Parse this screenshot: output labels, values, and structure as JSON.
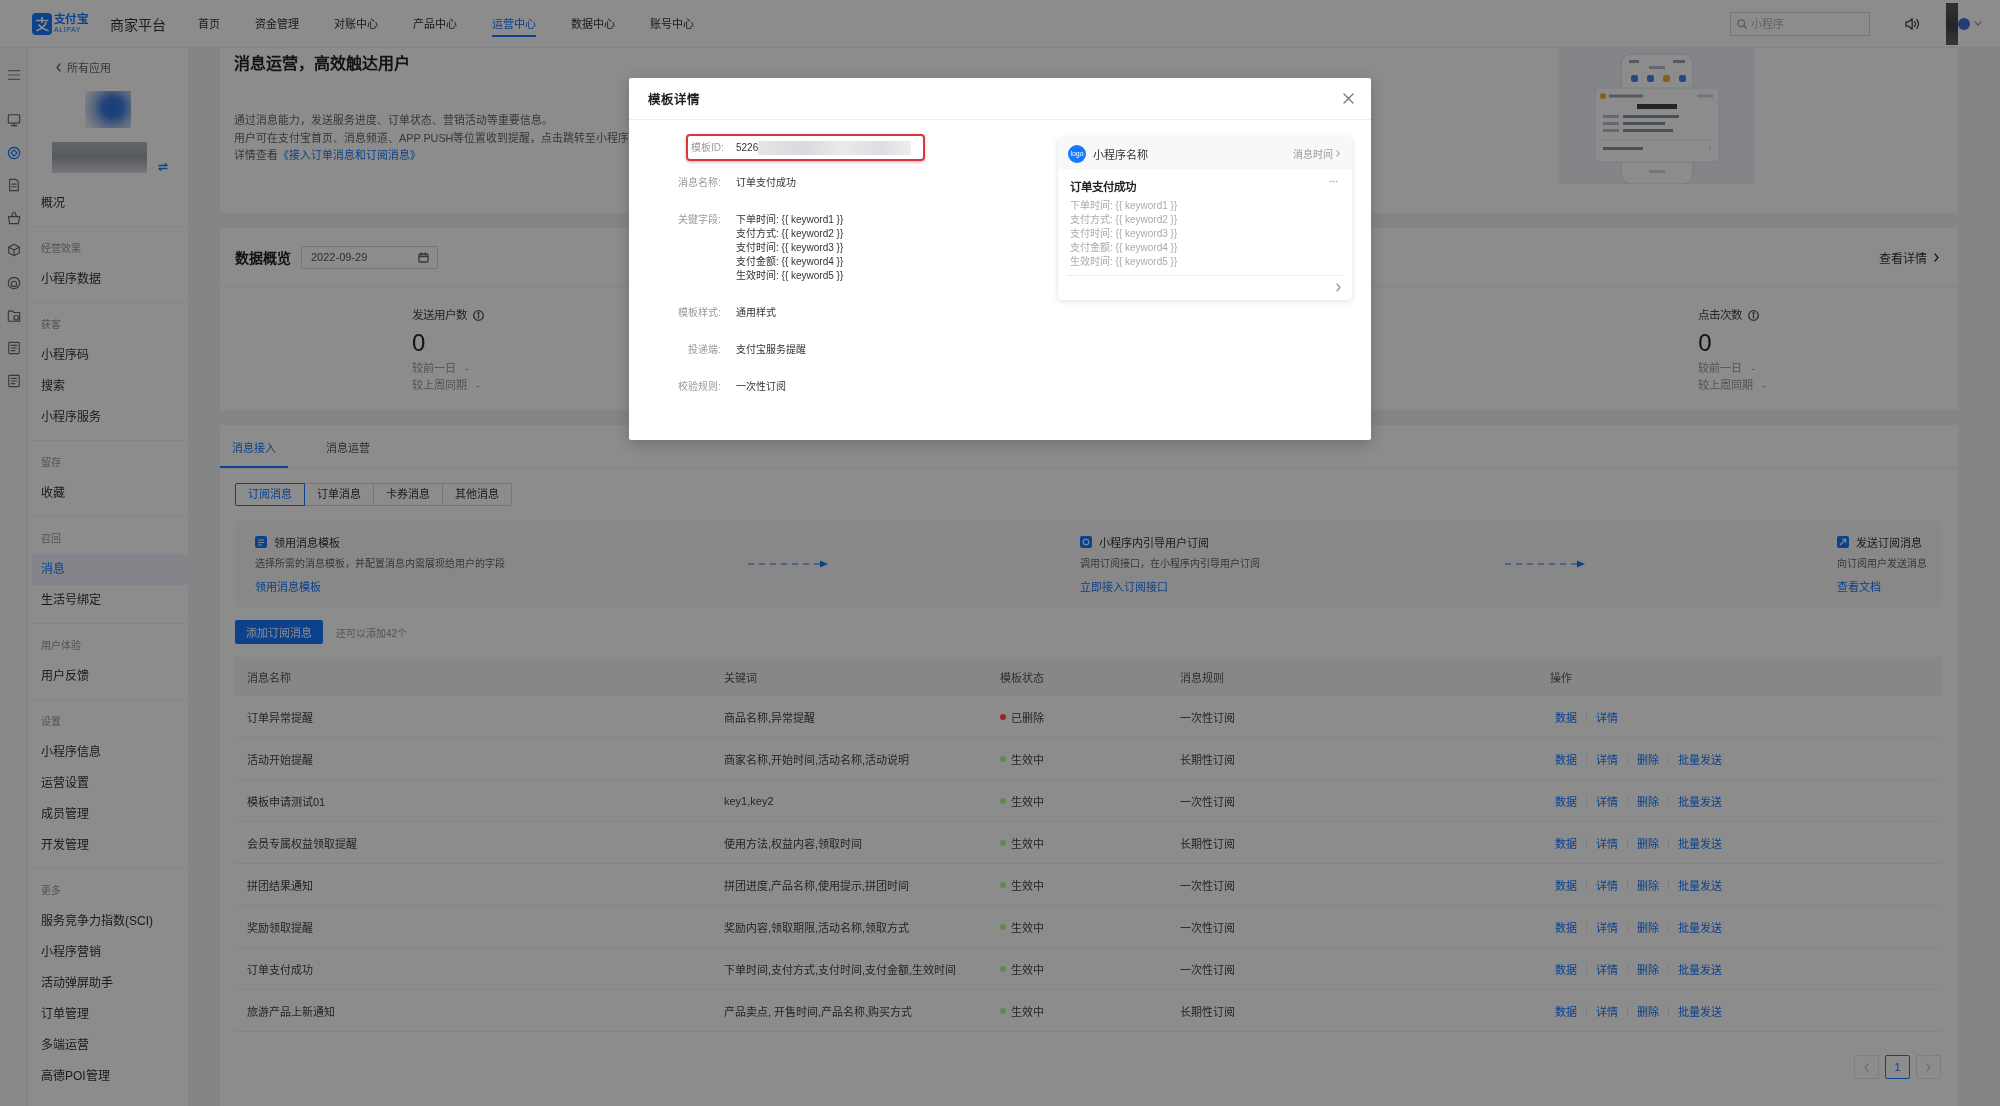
{
  "topbar": {
    "brand": "支付宝",
    "brand_sub": "ALIPAY",
    "platform": "商家平台",
    "nav": [
      {
        "label": "首页",
        "selected": false
      },
      {
        "label": "资金管理",
        "selected": false
      },
      {
        "label": "对账中心",
        "selected": false
      },
      {
        "label": "产品中心",
        "selected": false
      },
      {
        "label": "运营中心",
        "selected": true
      },
      {
        "label": "数据中心",
        "selected": false
      },
      {
        "label": "账号中心",
        "selected": false
      }
    ],
    "search": {
      "placeholder": "小程序"
    }
  },
  "rail": [
    {
      "selected": false
    },
    {
      "selected": true
    },
    {
      "selected": false
    },
    {
      "selected": false
    },
    {
      "selected": false
    },
    {
      "selected": false
    },
    {
      "selected": false
    },
    {
      "selected": false
    },
    {
      "selected": false
    }
  ],
  "sidebar": {
    "back_link": "所有应用",
    "sections": [
      {
        "items": [
          {
            "label": "概况",
            "selected": false
          }
        ]
      },
      {
        "title": "经营效果",
        "items": [
          {
            "label": "小程序数据",
            "selected": false
          }
        ]
      },
      {
        "title": "获客",
        "items": [
          {
            "label": "小程序码",
            "selected": false
          },
          {
            "label": "搜索",
            "selected": false
          },
          {
            "label": "小程序服务",
            "selected": false
          }
        ]
      },
      {
        "title": "留存",
        "items": [
          {
            "label": "收藏",
            "selected": false
          }
        ]
      },
      {
        "title": "召回",
        "items": [
          {
            "label": "消息",
            "selected": true
          },
          {
            "label": "生活号绑定",
            "selected": false
          }
        ]
      },
      {
        "title": "用户体验",
        "items": [
          {
            "label": "用户反馈",
            "selected": false
          }
        ]
      },
      {
        "title": "设置",
        "items": [
          {
            "label": "小程序信息",
            "selected": false
          },
          {
            "label": "运营设置",
            "selected": false
          },
          {
            "label": "成员管理",
            "selected": false
          },
          {
            "label": "开发管理",
            "selected": false
          }
        ]
      },
      {
        "title": "更多",
        "items": [
          {
            "label": "服务竞争力指数(SCI)",
            "selected": false
          },
          {
            "label": "小程序营销",
            "selected": false
          },
          {
            "label": "活动弹屏助手",
            "selected": false
          },
          {
            "label": "订单管理",
            "selected": false
          },
          {
            "label": "多端运营",
            "selected": false
          },
          {
            "label": "高德POI管理",
            "selected": false
          }
        ]
      }
    ]
  },
  "intro": {
    "title": "消息运营，高效触达用户",
    "lines": [
      "通过消息能力，发送服务进度、订单状态、营销活动等重要信息。",
      "用户可在支付宝首页、消息频道、APP PUSH等位置收到提醒，点击跳转至小程序"
    ],
    "doc_prefix": "详情查看",
    "doc_link": "《接入订单消息和订阅消息》"
  },
  "overview": {
    "title": "数据概览",
    "date": "2022-09-29",
    "details_link": "查看详情",
    "stats": [
      {
        "label": "发送用户数",
        "value": "0",
        "compare": [
          "较前一日 -",
          "较上周同期 -"
        ]
      },
      {
        "label": "点击次数",
        "value": "0",
        "compare": [
          "较前一日 -",
          "较上周同期 -"
        ]
      }
    ]
  },
  "messages": {
    "tabs": [
      {
        "label": "消息接入",
        "selected": true
      },
      {
        "label": "消息运营",
        "selected": false
      }
    ],
    "types": [
      {
        "label": "订阅消息",
        "selected": true
      },
      {
        "label": "订单消息",
        "selected": false
      },
      {
        "label": "卡券消息",
        "selected": false
      },
      {
        "label": "其他消息",
        "selected": false
      }
    ],
    "steps": [
      {
        "title": "领用消息模板",
        "desc": "选择所需的消息模板，并配置消息内需展现给用户的字段",
        "link": "领用消息模板"
      },
      {
        "title": "小程序内引导用户订阅",
        "desc": "调用订阅接口，在小程序内引导用户订阅",
        "link": "立即接入订阅接口"
      },
      {
        "title": "发送订阅消息",
        "desc": "向订阅用户发送消息",
        "link": "查看文档"
      }
    ],
    "add_button": "添加订阅消息",
    "quota": "还可以添加42个",
    "table": {
      "columns": [
        "消息名称",
        "关键词",
        "模板状态",
        "消息规则",
        "操作"
      ],
      "rows": [
        {
          "name": "订单异常提醒",
          "keywords": "商品名称,异常提醒",
          "status": {
            "label": "已删除",
            "color": "#9c2424"
          },
          "rule": "一次性订阅",
          "actions": [
            "数据",
            "详情"
          ]
        },
        {
          "name": "活动开始提醒",
          "keywords": "商家名称,开始时间,活动名称,活动说明",
          "status": {
            "label": "生效中",
            "color": "#5e8c45"
          },
          "rule": "长期性订阅",
          "actions": [
            "数据",
            "详情",
            "删除",
            "批量发送"
          ]
        },
        {
          "name": "模板申请测试01",
          "keywords": "key1,key2",
          "status": {
            "label": "生效中",
            "color": "#5e8c45"
          },
          "rule": "一次性订阅",
          "actions": [
            "数据",
            "详情",
            "删除",
            "批量发送"
          ]
        },
        {
          "name": "会员专属权益领取提醒",
          "keywords": "使用方法,权益内容,领取时间",
          "status": {
            "label": "生效中",
            "color": "#5e8c45"
          },
          "rule": "长期性订阅",
          "actions": [
            "数据",
            "详情",
            "删除",
            "批量发送"
          ]
        },
        {
          "name": "拼团结果通知",
          "keywords": "拼团进度,产品名称,使用提示,拼团时间",
          "status": {
            "label": "生效中",
            "color": "#5e8c45"
          },
          "rule": "一次性订阅",
          "actions": [
            "数据",
            "详情",
            "删除",
            "批量发送"
          ]
        },
        {
          "name": "奖励领取提醒",
          "keywords": "奖励内容,领取期限,活动名称,领取方式",
          "status": {
            "label": "生效中",
            "color": "#5e8c45"
          },
          "rule": "一次性订阅",
          "actions": [
            "数据",
            "详情",
            "删除",
            "批量发送"
          ]
        },
        {
          "name": "订单支付成功",
          "keywords": "下单时间,支付方式,支付时间,支付金额,生效时间",
          "status": {
            "label": "生效中",
            "color": "#5e8c45"
          },
          "rule": "一次性订阅",
          "actions": [
            "数据",
            "详情",
            "删除",
            "批量发送"
          ]
        },
        {
          "name": "旅游产品上新通知",
          "keywords": "产品卖点, 开售时间,产品名称,购买方式",
          "status": {
            "label": "生效中",
            "color": "#5e8c45"
          },
          "rule": "长期性订阅",
          "actions": [
            "数据",
            "详情",
            "删除",
            "批量发送"
          ]
        }
      ]
    },
    "pagination": {
      "prev_disabled": true,
      "pages": [
        {
          "label": "1",
          "selected": true
        }
      ],
      "next_disabled": true
    }
  },
  "modal": {
    "title": "模板详情",
    "fields": [
      {
        "label": "模板ID:",
        "lines": [
          "5226"
        ],
        "highlighted": true,
        "redacted": true
      },
      {
        "label": "消息名称:",
        "lines": [
          "订单支付成功"
        ],
        "highlighted": false,
        "redacted": false
      },
      {
        "label": "关键字段:",
        "lines": [
          "下单时间: {{ keyword1 }}",
          "支付方式: {{ keyword2 }}",
          "支付时间: {{ keyword3 }}",
          "支付金额: {{ keyword4 }}",
          "生效时间: {{ keyword5 }}"
        ],
        "highlighted": false,
        "redacted": false
      },
      {
        "label": "模板样式:",
        "lines": [
          "通用样式"
        ],
        "highlighted": false,
        "redacted": false
      },
      {
        "label": "投递端:",
        "lines": [
          "支付宝服务提醒"
        ],
        "highlighted": false,
        "redacted": false
      },
      {
        "label": "校验规则:",
        "lines": [
          "一次性订阅"
        ],
        "highlighted": false,
        "redacted": false
      }
    ],
    "preview": {
      "logo": "logo",
      "app_name": "小程序名称",
      "time_link": "消息时间",
      "title": "订单支付成功",
      "lines": [
        "下单时间: {{ keyword1 }}",
        "支付方式: {{ keyword2 }}",
        "支付时间: {{ keyword3 }}",
        "支付金额: {{ keyword4 }}",
        "生效时间: {{ keyword5 }}"
      ]
    }
  }
}
